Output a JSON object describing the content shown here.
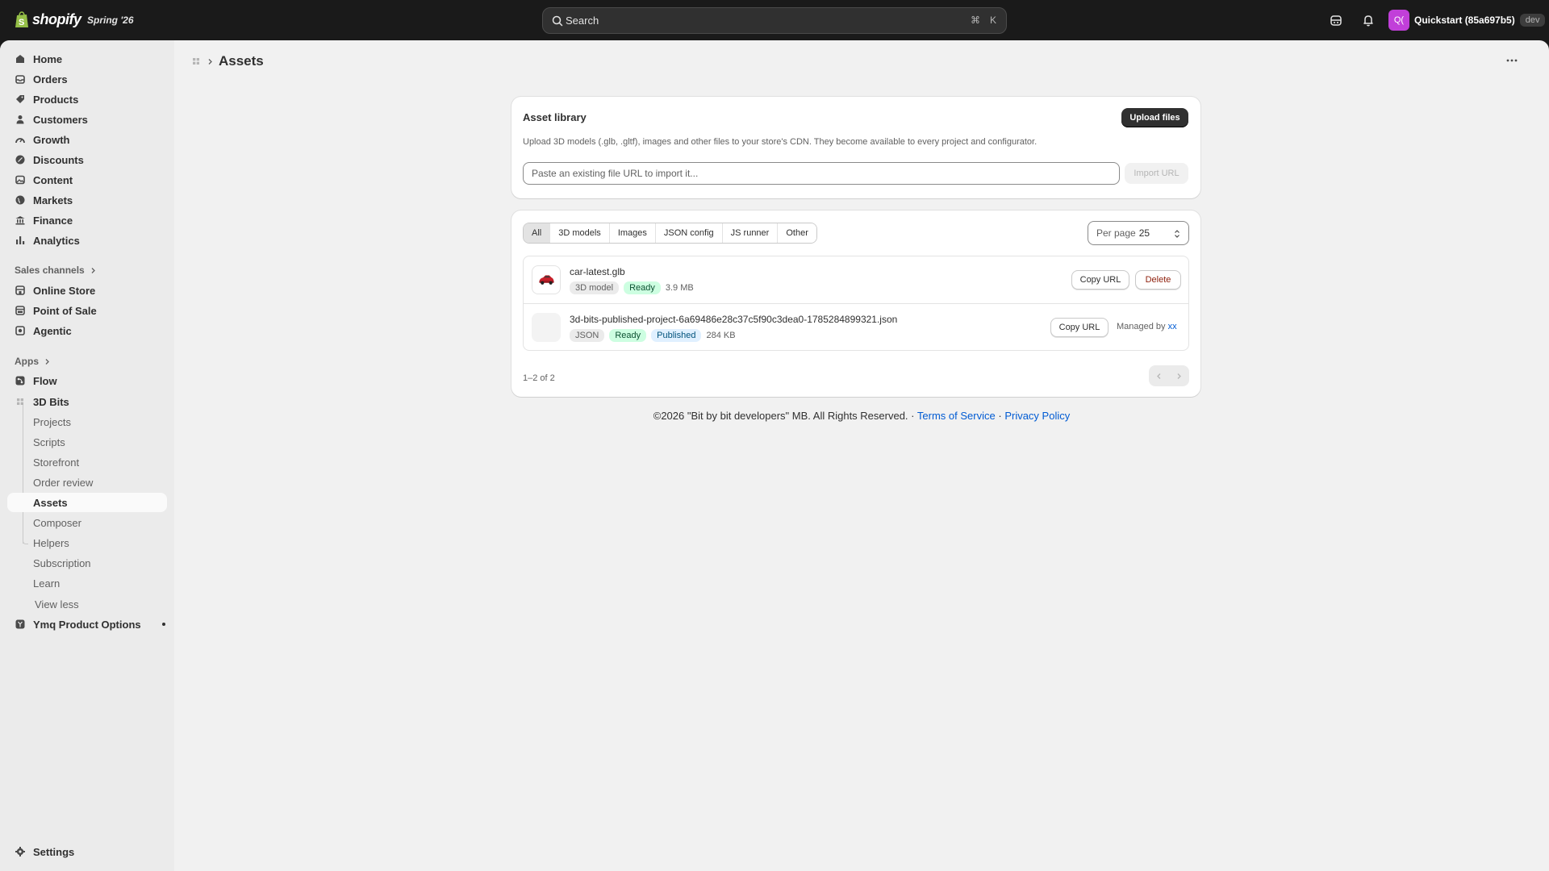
{
  "topbar": {
    "brand": "shopify",
    "edition": "Spring '26",
    "search_placeholder": "Search",
    "shortcut_cmd": "⌘",
    "shortcut_key": "K",
    "store_avatar": "Q(",
    "store_name": "Quickstart (85a697b5)",
    "dev_badge": "dev",
    "avatar_color": "#c13fd9"
  },
  "sidebar": {
    "main": [
      {
        "label": "Home",
        "icon": "home-icon"
      },
      {
        "label": "Orders",
        "icon": "orders-icon"
      },
      {
        "label": "Products",
        "icon": "tag-icon"
      },
      {
        "label": "Customers",
        "icon": "person-icon"
      },
      {
        "label": "Growth",
        "icon": "gauge-icon"
      },
      {
        "label": "Discounts",
        "icon": "discount-icon"
      },
      {
        "label": "Content",
        "icon": "image-icon"
      },
      {
        "label": "Markets",
        "icon": "globe-icon"
      },
      {
        "label": "Finance",
        "icon": "bank-icon"
      },
      {
        "label": "Analytics",
        "icon": "bar-chart-icon"
      }
    ],
    "sales_channels_label": "Sales channels",
    "sales_channels": [
      {
        "label": "Online Store",
        "icon": "store-icon"
      },
      {
        "label": "Point of Sale",
        "icon": "pos-icon"
      },
      {
        "label": "Agentic",
        "icon": "agent-icon"
      }
    ],
    "apps_label": "Apps",
    "apps": [
      {
        "label": "Flow",
        "icon": "flow-icon"
      },
      {
        "label": "3D Bits",
        "icon": "app-icon"
      }
    ],
    "app_sub": [
      "Projects",
      "Scripts",
      "Storefront",
      "Order review",
      "Assets",
      "Composer",
      "Helpers",
      "Subscription",
      "Learn"
    ],
    "view_less": "View less",
    "ymq": "Ymq Product Options",
    "settings": "Settings"
  },
  "page": {
    "title": "Assets"
  },
  "library": {
    "title": "Asset library",
    "upload_button": "Upload files",
    "description": "Upload 3D models (.glb, .gltf), images and other files to your store's CDN. They become available to every project and configurator.",
    "url_placeholder": "Paste an existing file URL to import it...",
    "import_button": "Import URL"
  },
  "list": {
    "tabs": [
      "All",
      "3D models",
      "Images",
      "JSON config",
      "JS runner",
      "Other"
    ],
    "active_tab": "All",
    "per_page_label": "Per page",
    "per_page_value": "25",
    "items": [
      {
        "name": "car-latest.glb",
        "type": "3D model",
        "status": "Ready",
        "size": "3.9 MB",
        "copy": "Copy URL",
        "delete": "Delete"
      },
      {
        "name": "3d-bits-published-project-6a69486e28c37c5f90c3dea0-1785284899321.json",
        "type": "JSON",
        "status": "Ready",
        "published": "Published",
        "size": "284 KB",
        "copy": "Copy URL",
        "managed_by": "Managed by",
        "managed_link": "xx"
      }
    ],
    "range": "1–2 of 2"
  },
  "footer": {
    "copyright": "©2026 \"Bit by bit developers\" MB. All Rights Reserved.",
    "sep": "·",
    "terms": "Terms of Service",
    "privacy": "Privacy Policy"
  }
}
